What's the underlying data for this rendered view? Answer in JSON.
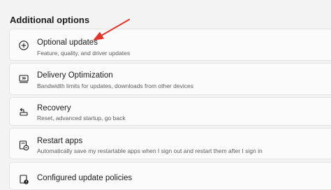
{
  "section": {
    "title": "Additional options"
  },
  "options": [
    {
      "title": "Optional updates",
      "subtitle": "Feature, quality, and driver updates",
      "icon": "plus-circle-icon"
    },
    {
      "title": "Delivery Optimization",
      "subtitle": "Bandwidth limits for updates, downloads from other devices",
      "icon": "delivery-optimization-icon"
    },
    {
      "title": "Recovery",
      "subtitle": "Reset, advanced startup, go back",
      "icon": "recovery-icon"
    },
    {
      "title": "Restart apps",
      "subtitle": "Automatically save my restartable apps when I sign out and restart them after I sign in",
      "icon": "restart-apps-icon"
    },
    {
      "title": "Configured update policies",
      "subtitle": "",
      "icon": "update-policies-icon"
    }
  ],
  "annotation": {
    "arrow_color": "#e0352b",
    "icon": "red-arrow-icon"
  }
}
